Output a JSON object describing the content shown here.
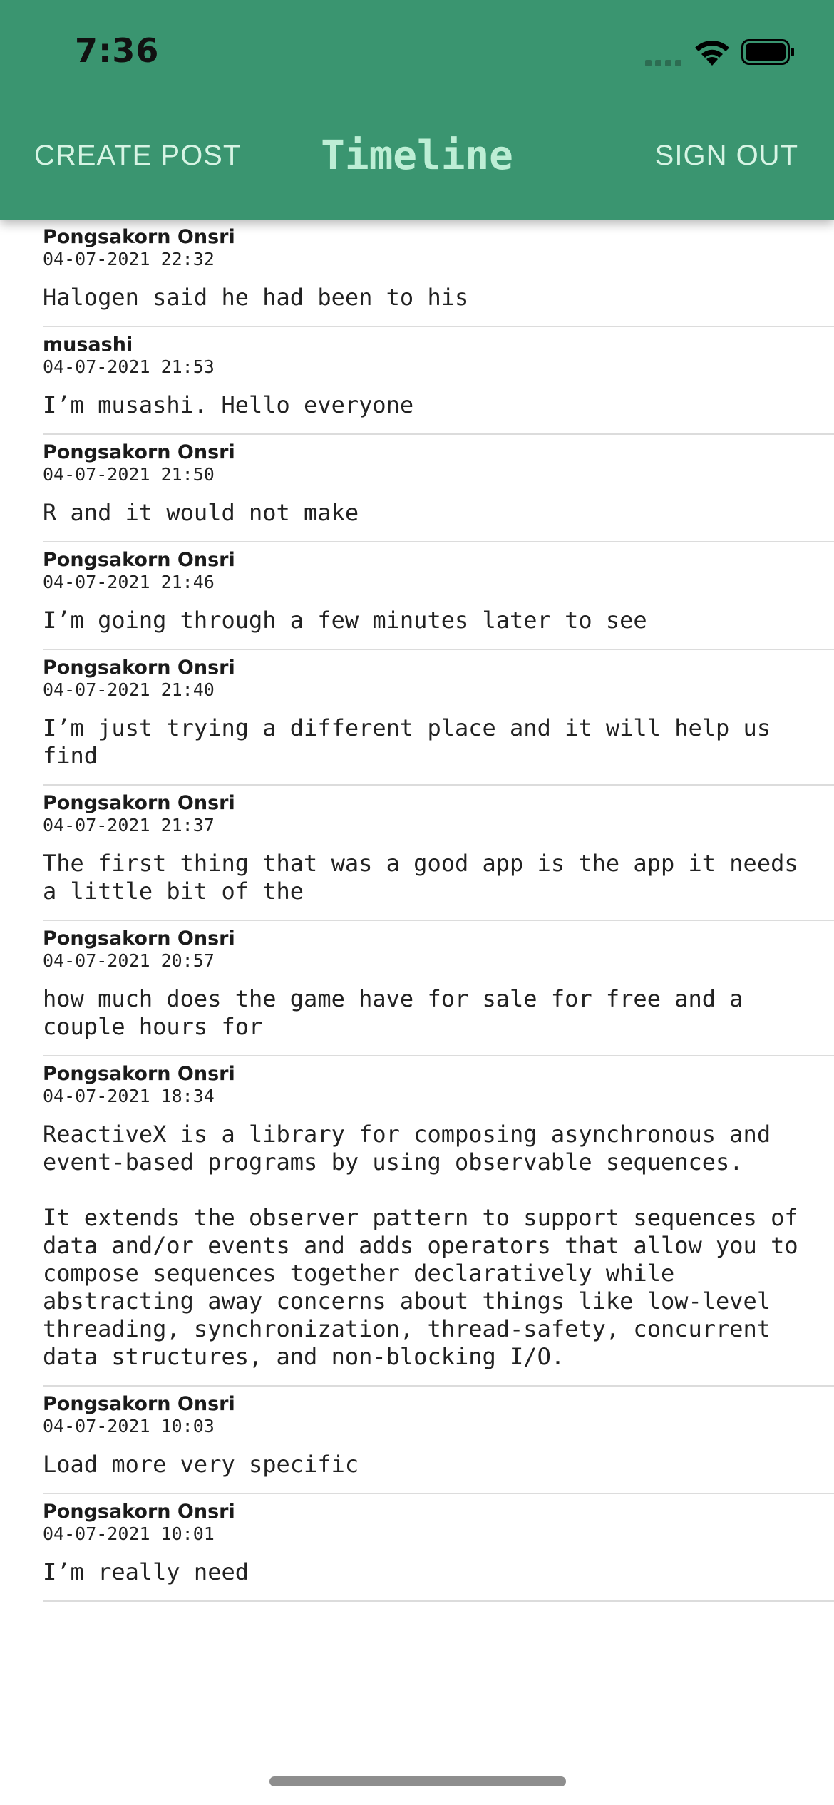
{
  "status_bar": {
    "time": "7:36"
  },
  "nav": {
    "title": "Timeline",
    "create_post_label": "CREATE POST",
    "sign_out_label": "SIGN OUT"
  },
  "posts": [
    {
      "author": "Pongsakorn Onsri",
      "date": "04-07-2021 22:32",
      "text": "Halogen said he had been to his"
    },
    {
      "author": "musashi",
      "date": "04-07-2021 21:53",
      "text": "I’m musashi. Hello everyone"
    },
    {
      "author": "Pongsakorn Onsri",
      "date": "04-07-2021 21:50",
      "text": "R and it would not make"
    },
    {
      "author": "Pongsakorn Onsri",
      "date": "04-07-2021 21:46",
      "text": "I’m going through a few minutes later to see"
    },
    {
      "author": "Pongsakorn Onsri",
      "date": "04-07-2021 21:40",
      "text": "I’m just trying a different place and it will help us find"
    },
    {
      "author": "Pongsakorn Onsri",
      "date": "04-07-2021 21:37",
      "text": "The first thing that was a good app is the app it needs a little bit of the"
    },
    {
      "author": "Pongsakorn Onsri",
      "date": "04-07-2021 20:57",
      "text": "how much does the game have for sale for free and a couple hours for"
    },
    {
      "author": "Pongsakorn Onsri",
      "date": "04-07-2021 18:34",
      "text": "ReactiveX is a library for composing asynchronous and event-based programs by using observable sequences.\n\nIt extends the observer pattern to support sequences of data and/or events and adds operators that allow you to compose sequences together declaratively while abstracting away concerns about things like low-level threading, synchronization, thread-safety, concurrent data structures, and non-blocking I/O."
    },
    {
      "author": "Pongsakorn Onsri",
      "date": "04-07-2021 10:03",
      "text": "Load more very specific"
    },
    {
      "author": "Pongsakorn Onsri",
      "date": "04-07-2021 10:01",
      "text": "I’m really need"
    }
  ],
  "colors": {
    "header_bg": "#3a9570",
    "nav_text": "#d7f4e4",
    "title_text": "#bdeed5"
  }
}
